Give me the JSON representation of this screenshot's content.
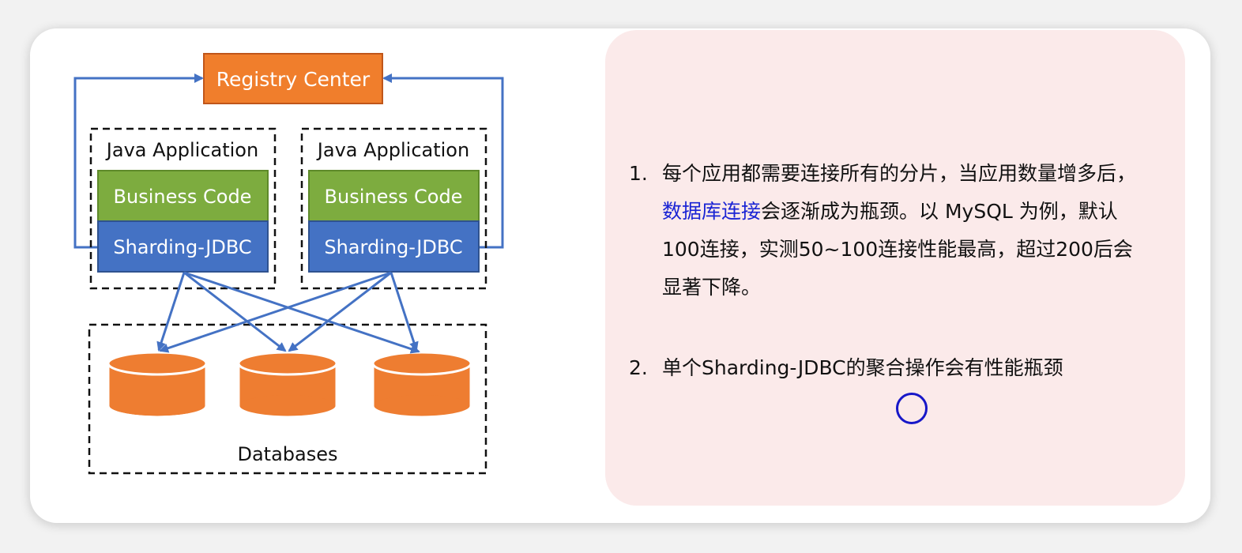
{
  "diagram": {
    "registry_label": "Registry Center",
    "apps": [
      {
        "title": "Java Application",
        "business": "Business Code",
        "sharding": "Sharding-JDBC"
      },
      {
        "title": "Java Application",
        "business": "Business Code",
        "sharding": "Sharding-JDBC"
      }
    ],
    "databases_label": "Databases",
    "colors": {
      "registry_fill": "#f07e2c",
      "business_fill": "#7dac3f",
      "sharding_fill": "#4472c4",
      "database_fill": "#ee7d31",
      "arrow": "#4472c4"
    }
  },
  "notes": {
    "item1": {
      "number": "1.",
      "line1": "每个应用都需要连接所有的分片，当应用数量增多后，",
      "highlight": "数据库连接",
      "line2_rest": "会逐渐成为瓶颈。以 MySQL 为例，默认",
      "line3": "100连接，实测50~100连接性能最高，超过200后会",
      "line4": "显著下降。"
    },
    "item2": {
      "number": "2.",
      "text": "单个Sharding-JDBC的聚合操作会有性能瓶颈"
    },
    "colors": {
      "panel_bg": "#fbeaea",
      "highlight": "#1a24d4"
    }
  }
}
